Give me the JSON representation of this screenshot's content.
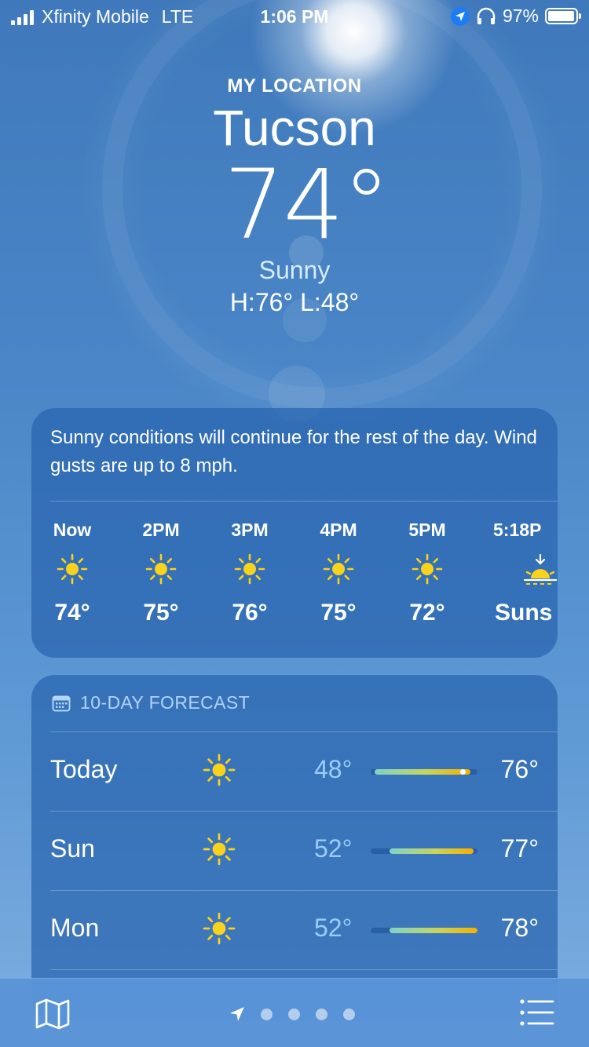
{
  "status_bar": {
    "carrier": "Xfinity Mobile",
    "network": "LTE",
    "time": "1:06 PM",
    "battery": "97%",
    "battery_level": 0.97,
    "icons": [
      "signal-icon",
      "location-icon",
      "headphones-icon",
      "battery-icon"
    ]
  },
  "header": {
    "location_label": "MY LOCATION",
    "city": "Tucson",
    "temperature": "74°",
    "condition": "Sunny",
    "high_low": "H:76°  L:48°"
  },
  "hourly": {
    "summary": "Sunny conditions will continue for the rest of the day. Wind gusts are up to 8 mph.",
    "hours": [
      {
        "label": "Now",
        "icon": "sun-icon",
        "temp": "74°"
      },
      {
        "label": "2PM",
        "icon": "sun-icon",
        "temp": "75°"
      },
      {
        "label": "3PM",
        "icon": "sun-icon",
        "temp": "76°"
      },
      {
        "label": "4PM",
        "icon": "sun-icon",
        "temp": "75°"
      },
      {
        "label": "5PM",
        "icon": "sun-icon",
        "temp": "72°"
      },
      {
        "label": "5:18P",
        "icon": "sunset-icon",
        "temp": "Suns"
      }
    ]
  },
  "forecast": {
    "title": "10-DAY FORECAST",
    "icon": "calendar-icon",
    "range_low": 48,
    "range_high": 78,
    "days": [
      {
        "day": "Today",
        "icon": "sun-icon",
        "low": "48°",
        "high": "76°",
        "low_value": 48,
        "high_value": 76,
        "current_value": 74
      },
      {
        "day": "Sun",
        "icon": "sun-icon",
        "low": "52°",
        "high": "77°",
        "low_value": 52,
        "high_value": 77
      },
      {
        "day": "Mon",
        "icon": "sun-icon",
        "low": "52°",
        "high": "78°",
        "low_value": 52,
        "high_value": 78
      }
    ]
  },
  "tab_bar": {
    "left_icon": "map-icon",
    "right_icon": "list-icon",
    "pages": 4,
    "current_page_icon": "location-arrow-icon"
  },
  "colors": {
    "accent_blue": "#1e7cf2",
    "sun_yellow": "#f8d21c",
    "sun_orange": "#f6b000",
    "low_temp_blue": "#a0d2ff"
  }
}
